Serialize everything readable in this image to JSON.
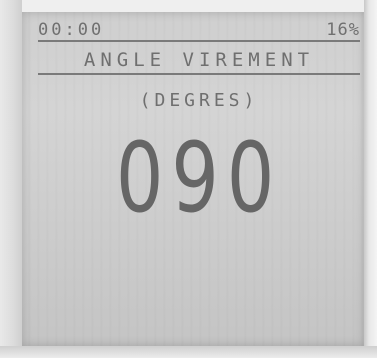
{
  "status": {
    "clock": "00:00",
    "battery": "16%"
  },
  "screen": {
    "title": "ANGLE VIREMENT",
    "subtitle": "(DEGRES)",
    "value": "090"
  }
}
